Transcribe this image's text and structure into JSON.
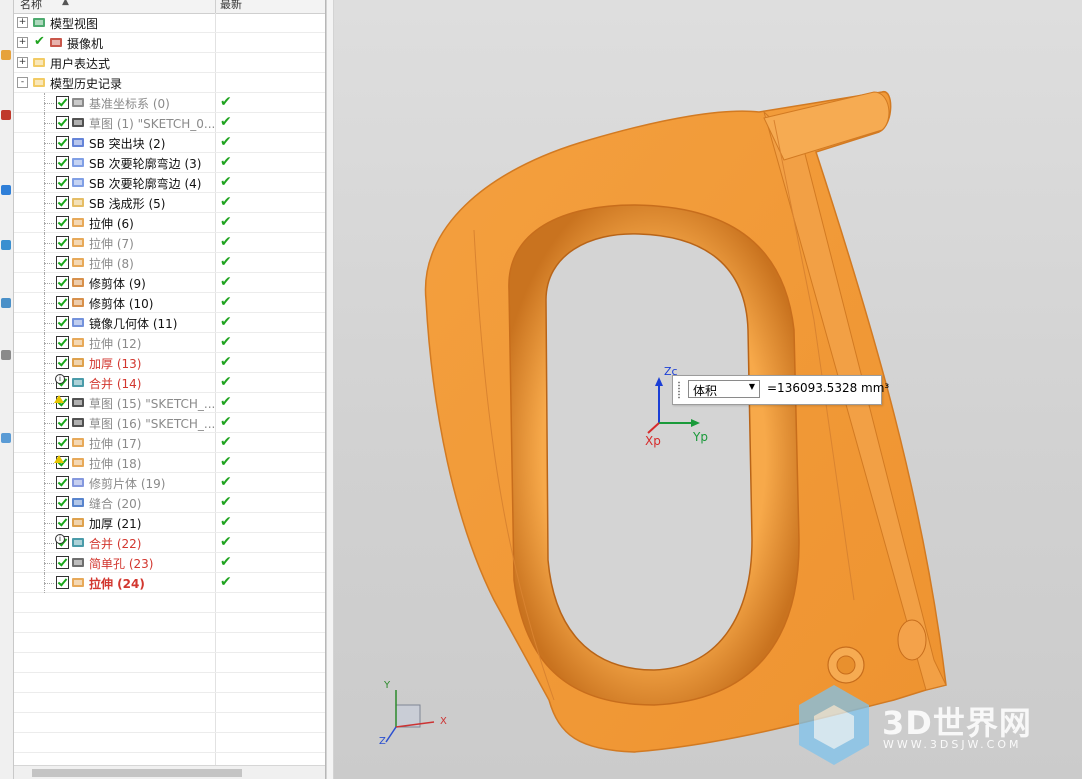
{
  "navigator": {
    "columns": {
      "name": "名称",
      "latest": "最新"
    },
    "nodes": [
      {
        "label": "模型视图",
        "style": "normal",
        "icon": "model-views-icon",
        "expand": "+",
        "latest": ""
      },
      {
        "label": "摄像机",
        "style": "normal",
        "icon": "camera-icon",
        "expand": "+",
        "latest": ""
      },
      {
        "label": "用户表达式",
        "style": "normal",
        "icon": "folder-icon",
        "expand": "+",
        "latest": ""
      },
      {
        "label": "模型历史记录",
        "style": "normal",
        "icon": "folder-open-icon",
        "expand": "-",
        "latest": ""
      }
    ],
    "features": [
      {
        "label": "基准坐标系 (0)",
        "style": "gray",
        "icon": "datum-csys-icon",
        "latest": "✔"
      },
      {
        "label": "草图 (1) \"SKETCH_0...",
        "style": "gray",
        "icon": "sketch-icon",
        "latest": "✔"
      },
      {
        "label": "SB 突出块 (2)",
        "style": "normal",
        "icon": "tab-icon",
        "latest": "✔"
      },
      {
        "label": "SB 次要轮廓弯边 (3)",
        "style": "normal",
        "icon": "contour-flange-icon",
        "latest": "✔"
      },
      {
        "label": "SB 次要轮廓弯边 (4)",
        "style": "normal",
        "icon": "contour-flange-icon",
        "latest": "✔"
      },
      {
        "label": "SB 浅成形 (5)",
        "style": "normal",
        "icon": "dimple-icon",
        "latest": "✔"
      },
      {
        "label": "拉伸 (6)",
        "style": "normal",
        "icon": "extrude-icon",
        "latest": "✔"
      },
      {
        "label": "拉伸 (7)",
        "style": "gray",
        "icon": "extrude-icon",
        "latest": "✔"
      },
      {
        "label": "拉伸 (8)",
        "style": "gray",
        "icon": "extrude-icon",
        "latest": "✔"
      },
      {
        "label": "修剪体 (9)",
        "style": "normal",
        "icon": "trim-body-icon",
        "latest": "✔"
      },
      {
        "label": "修剪体 (10)",
        "style": "normal",
        "icon": "trim-body-icon",
        "latest": "✔"
      },
      {
        "label": "镜像几何体 (11)",
        "style": "normal",
        "icon": "mirror-geometry-icon",
        "latest": "✔"
      },
      {
        "label": "拉伸 (12)",
        "style": "gray",
        "icon": "extrude-icon",
        "latest": "✔"
      },
      {
        "label": "加厚 (13)",
        "style": "red",
        "icon": "thicken-icon",
        "latest": "✔"
      },
      {
        "label": "合并 (14)",
        "style": "red",
        "icon": "unite-icon",
        "badge": "info",
        "latest": "✔"
      },
      {
        "label": "草图 (15) \"SKETCH_...",
        "style": "gray",
        "icon": "sketch-icon",
        "badge": "warn",
        "latest": "✔"
      },
      {
        "label": "草图 (16) \"SKETCH_...",
        "style": "gray",
        "icon": "sketch-icon",
        "latest": "✔"
      },
      {
        "label": "拉伸 (17)",
        "style": "gray",
        "icon": "extrude-icon",
        "latest": "✔"
      },
      {
        "label": "拉伸 (18)",
        "style": "gray",
        "icon": "extrude-icon",
        "badge": "warn",
        "latest": "✔"
      },
      {
        "label": "修剪片体 (19)",
        "style": "gray",
        "icon": "trim-sheet-icon",
        "latest": "✔"
      },
      {
        "label": "缝合 (20)",
        "style": "gray",
        "icon": "sew-icon",
        "latest": "✔"
      },
      {
        "label": "加厚 (21)",
        "style": "normal",
        "icon": "thicken-icon",
        "latest": "✔"
      },
      {
        "label": "合并 (22)",
        "style": "red",
        "icon": "unite-icon",
        "badge": "info",
        "latest": "✔"
      },
      {
        "label": "简单孔 (23)",
        "style": "red",
        "icon": "hole-icon",
        "latest": "✔"
      },
      {
        "label": "拉伸 (24)",
        "style": "red-bold",
        "icon": "extrude-icon",
        "latest": "✔"
      }
    ]
  },
  "measure": {
    "type_option": "体积",
    "value": "=136093.5328 mm³"
  },
  "wcs": {
    "z": "Zc",
    "x": "Xp",
    "y": "Yp"
  },
  "view_triad": {
    "y": "Y",
    "x": "X",
    "z": "Z"
  },
  "watermark": {
    "brand": "3D世界网",
    "url": "WWW.3DSJW.COM"
  },
  "colors": {
    "part": "#f29a3a",
    "part_shadow": "#c86a18",
    "check": "#1fa31f",
    "error_red": "#d2372f"
  }
}
